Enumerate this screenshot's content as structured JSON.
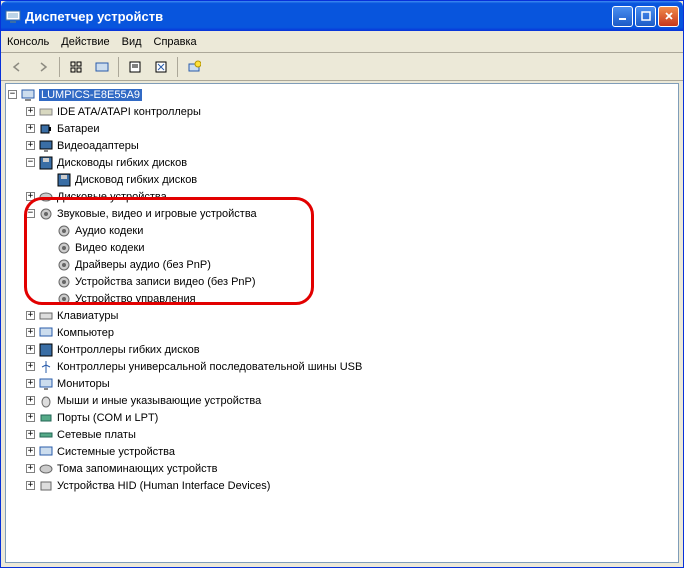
{
  "title": "Диспетчер устройств",
  "menu": {
    "console": "Консоль",
    "action": "Действие",
    "view": "Вид",
    "help": "Справка"
  },
  "root": "LUMPICS-E8E55A9",
  "nodes": {
    "ide": "IDE ATA/ATAPI контроллеры",
    "battery": "Батареи",
    "video": "Видеоадаптеры",
    "floppy_drives": "Дисководы гибких дисков",
    "floppy_drive_item": "Дисковод гибких дисков",
    "disk_drives": "Дисковые устройства",
    "sound": "Звуковые, видео и игровые устройства",
    "audio_codecs": "Аудио кодеки",
    "video_codecs": "Видео кодеки",
    "audio_drivers": "Драйверы аудио (без PnP)",
    "video_rec": "Устройства записи видео (без PnP)",
    "control_dev": "Устройство управления",
    "keyboards": "Клавиатуры",
    "computer": "Компьютер",
    "floppy_ctrl": "Контроллеры гибких дисков",
    "usb": "Контроллеры универсальной последовательной шины USB",
    "monitors": "Мониторы",
    "mice": "Мыши и иные указывающие устройства",
    "ports": "Порты (COM и LPT)",
    "network": "Сетевые платы",
    "system": "Системные устройства",
    "storage_vols": "Тома запоминающих устройств",
    "hid": "Устройства HID (Human Interface Devices)"
  }
}
